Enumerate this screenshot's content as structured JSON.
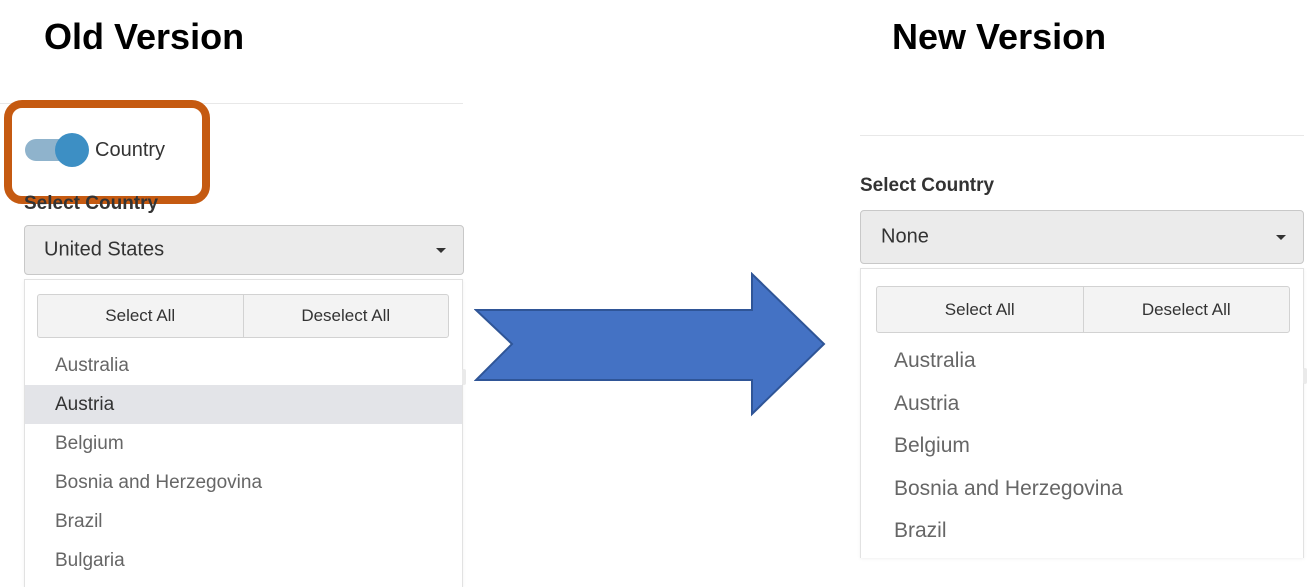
{
  "old": {
    "heading": "Old Version",
    "toggle": {
      "label": "Country",
      "on": true
    },
    "field_label": "Select Country",
    "selected": "United States",
    "actions": {
      "select_all": "Select All",
      "deselect_all": "Deselect All"
    },
    "options": [
      "Australia",
      "Austria",
      "Belgium",
      "Bosnia and Herzegovina",
      "Brazil",
      "Bulgaria"
    ],
    "active_option": "Austria"
  },
  "new": {
    "heading": "New Version",
    "field_label": "Select Country",
    "selected": "None",
    "actions": {
      "select_all": "Select All",
      "deselect_all": "Deselect All"
    },
    "options": [
      "Australia",
      "Austria",
      "Belgium",
      "Bosnia and Herzegovina",
      "Brazil"
    ]
  },
  "colors": {
    "highlight_border": "#c55a11",
    "arrow_fill": "#4472c4",
    "toggle_knob": "#3d8fc4",
    "toggle_track": "#8fb3cc"
  }
}
